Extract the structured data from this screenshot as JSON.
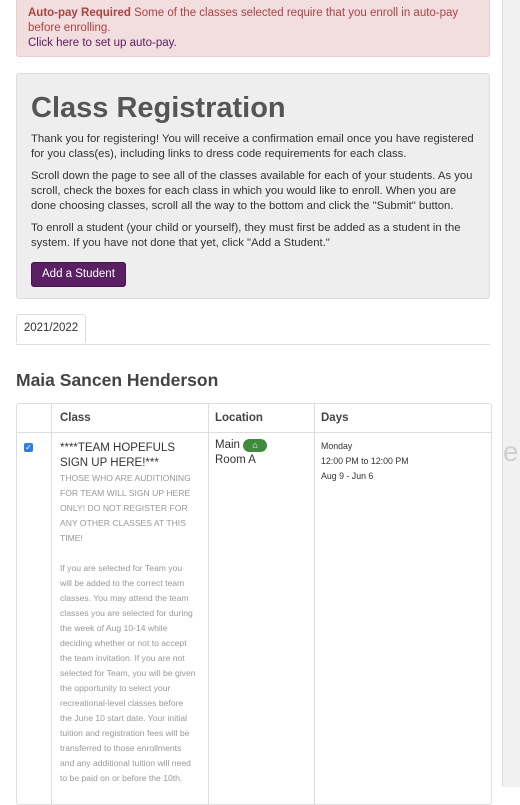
{
  "alert": {
    "title": "Auto-pay Required",
    "message": "Some of the classes selected require that you enroll in auto-pay before enrolling.",
    "link": "Click here to set up auto-pay."
  },
  "registration": {
    "title": "Class Registration",
    "paragraphs": [
      "Thank you for registering! You will receive a confirmation email once you have registered for you class(es), including links to dress code requirements for each class.",
      "Scroll down the page to see all of the classes available for each of your students. As you scroll, check the boxes for each class in which you would like to enroll. When you are done choosing classes, scroll all the way to the bottom and click the \"Submit\" button.",
      "To enroll a student (your child or yourself), they must first be added as a student in the system. If you have not done that yet, click \"Add a Student.\""
    ],
    "add_button": "Add a Student"
  },
  "tabs": [
    "2021/2022"
  ],
  "student": {
    "name": "Maia Sancen Henderson"
  },
  "table": {
    "headers": {
      "class": "Class",
      "location": "Location",
      "days": "Days"
    },
    "rows": [
      {
        "checked": true,
        "title": "****TEAM HOPEFULS SIGN UP HERE!***",
        "description_lines": [
          "THOSE WHO ARE AUDITIONING",
          "FOR TEAM WILL SIGN UP HERE",
          "ONLY! DO NOT REGISTER FOR",
          "ANY OTHER CLASSES AT THIS",
          "TIME!",
          "",
          "If you are selected for Team you",
          "will be added to the correct team",
          "classes. You may attend the team",
          "classes you are selected for during",
          "the week of Aug 10-14 while",
          "deciding whether or not to accept",
          "the team invitation. If you are not",
          "selected for Team, you will be given",
          "the opportunity to select your",
          "recreational-level classes before",
          "the June 10 start date. Your initial",
          "tuition and registration fees will be",
          "transferred to those enrollments",
          "and any additional tuition will need",
          "to be paid on or before the 10th."
        ],
        "location": "Main",
        "room": "Room A",
        "day": "Monday",
        "time": "12:00 PM to 12:00 PM",
        "dates": "Aug 9 - Jun 6"
      }
    ]
  },
  "page_edge_text": "el",
  "colors": {
    "alert_bg": "#f2dede",
    "alert_text": "#a94442",
    "brand_purple": "#5b1f63",
    "home_badge": "#3f8a3d",
    "checkbox": "#2f7de1"
  },
  "icons": {
    "location_badge": "home-icon",
    "checkbox": "checkbox-checked-icon"
  }
}
